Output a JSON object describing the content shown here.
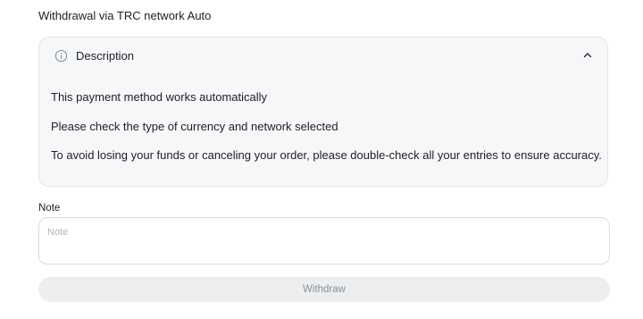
{
  "page_title": "Withdrawal via TRC network Auto",
  "description_panel": {
    "title": "Description",
    "icon": "info-icon",
    "toggle_icon": "chevron-up-icon",
    "expanded": true,
    "lines": [
      "This payment method works automatically",
      "Please check the type of currency and network selected",
      "To avoid losing your funds or canceling your order, please double-check all your entries to ensure accuracy."
    ]
  },
  "note": {
    "label": "Note",
    "placeholder": "Note",
    "value": ""
  },
  "withdraw_button": {
    "label": "Withdraw",
    "disabled": true
  },
  "colors": {
    "panel_bg": "#f6f7f8",
    "button_bg": "#eceef0",
    "button_text": "#8a8f96",
    "text": "#1d1f24"
  }
}
